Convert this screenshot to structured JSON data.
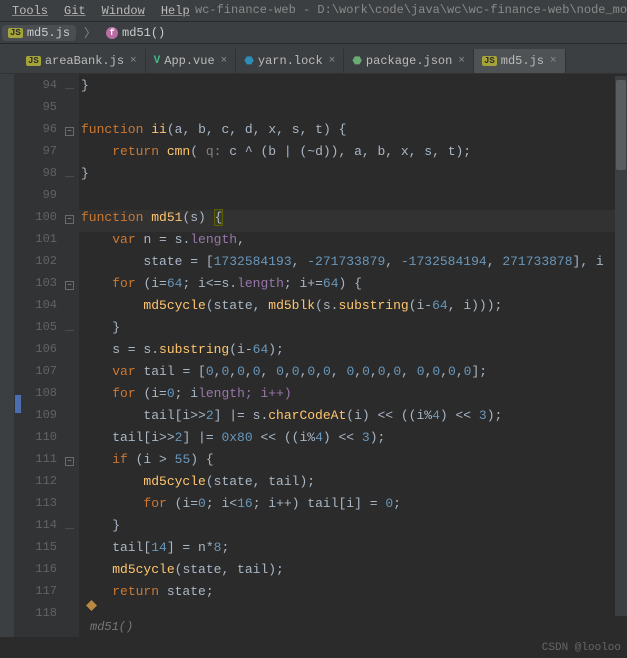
{
  "menubar": {
    "tools": "Tools",
    "git": "Git",
    "window": "Window",
    "help": "Help"
  },
  "titlepath": "wc-finance-web - D:\\work\\code\\java\\wc\\wc-finance-web\\node_modules\\c",
  "nav": {
    "file": "md5.js",
    "func": "md51()"
  },
  "tabs": [
    {
      "label": "areaBank.js",
      "icon": "js",
      "active": false
    },
    {
      "label": "App.vue",
      "icon": "vue",
      "active": false
    },
    {
      "label": "yarn.lock",
      "icon": "yarn",
      "active": false
    },
    {
      "label": "package.json",
      "icon": "json",
      "active": false
    },
    {
      "label": "md5.js",
      "icon": "js",
      "active": true
    }
  ],
  "gutter": {
    "start": 94,
    "end": 118
  },
  "bottomHint": "md51()",
  "watermark": "CSDN @looloo",
  "code": {
    "94": "}",
    "95": "",
    "96": {
      "kw": "function ",
      "fn": "ii",
      "rest": "(a, b, c, d, x, s, t) {"
    },
    "97": {
      "indent": "    ",
      "kw": "return ",
      "fn": "cmn",
      "rest": "( q: c ^ (b | (~d)), a, b, x, s, t);"
    },
    "98": "}",
    "99": "",
    "100": {
      "kw": "function ",
      "fn": "md51",
      "args": "(s) ",
      "brace": "{"
    },
    "101": {
      "indent": "    ",
      "kw": "var ",
      "rest1": "n = s.",
      "prop": "length",
      "rest2": ","
    },
    "102": {
      "indent": "        ",
      "rest1": "state = [",
      "nums": "1732584193, -271733879, -1732584194, 271733878",
      "rest2": "], i"
    },
    "103": {
      "indent": "    ",
      "kw": "for ",
      "rest1": "(i=",
      "n1": "64",
      "rest2": "; i<=s.",
      "prop": "length",
      "rest3": "; i+=",
      "n2": "64",
      "rest4": ") {"
    },
    "104": {
      "indent": "        ",
      "fn": "md5cycle",
      "rest1": "(state, ",
      "fn2": "md5blk",
      "rest2": "(s.",
      "fn3": "substring",
      "rest3": "(i-",
      "n1": "64",
      "rest4": ", i)));"
    },
    "105": {
      "indent": "    ",
      "rest": "}"
    },
    "106": {
      "indent": "    ",
      "rest1": "s = s.",
      "fn": "substring",
      "rest2": "(i-",
      "n1": "64",
      "rest3": ");"
    },
    "107": {
      "indent": "    ",
      "kw": "var ",
      "rest1": "tail = [",
      "nums": "0,0,0,0, 0,0,0,0, 0,0,0,0, 0,0,0,0",
      "rest2": "];"
    },
    "108": {
      "indent": "    ",
      "kw": "for ",
      "rest1": "(i=",
      "n1": "0",
      "rest2": "; i<s.",
      "prop": "length",
      "rest3": "; i++)"
    },
    "109": {
      "indent": "        ",
      "rest1": "tail[i>>",
      "n1": "2",
      "rest2": "] |= s.",
      "fn": "charCodeAt",
      "rest3": "(i) << ((i%",
      "n2": "4",
      "rest4": ") << ",
      "n3": "3",
      "rest5": ");"
    },
    "110": {
      "indent": "    ",
      "rest1": "tail[i>>",
      "n1": "2",
      "rest2": "] |= ",
      "hex": "0x80",
      "rest3": " << ((i%",
      "n2": "4",
      "rest4": ") << ",
      "n3": "3",
      "rest5": ");"
    },
    "111": {
      "indent": "    ",
      "kw": "if ",
      "rest1": "(i > ",
      "n1": "55",
      "rest2": ") {"
    },
    "112": {
      "indent": "        ",
      "fn": "md5cycle",
      "rest": "(state, tail);"
    },
    "113": {
      "indent": "        ",
      "kw": "for ",
      "rest1": "(i=",
      "n1": "0",
      "rest2": "; i<",
      "n2": "16",
      "rest3": "; i++) tail[i] = ",
      "n3": "0",
      "rest4": ";"
    },
    "114": {
      "indent": "    ",
      "rest": "}"
    },
    "115": {
      "indent": "    ",
      "rest1": "tail[",
      "n1": "14",
      "rest2": "] = n*",
      "n2": "8",
      "rest3": ";"
    },
    "116": {
      "indent": "    ",
      "fn": "md5cycle",
      "rest": "(state, tail);"
    },
    "117": {
      "indent": "    ",
      "kw": "return ",
      "rest": "state;"
    },
    "118": ""
  }
}
